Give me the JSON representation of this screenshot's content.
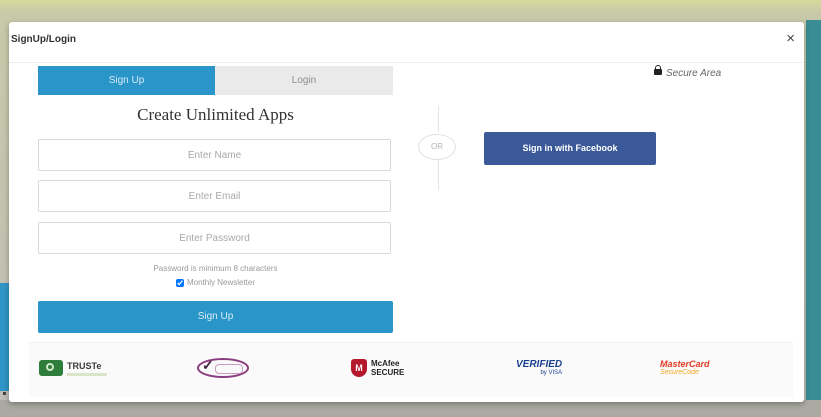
{
  "modal": {
    "title": "SignUp/Login",
    "close_glyph": "×",
    "secure_label": "Secure Area",
    "secure_icon": "lock-icon"
  },
  "tabs": [
    {
      "label": "Sign Up",
      "active": true
    },
    {
      "label": "Login",
      "active": false
    }
  ],
  "form": {
    "headline": "Create Unlimited Apps",
    "name_placeholder": "Enter Name",
    "email_placeholder": "Enter Email",
    "password_placeholder": "Enter Password",
    "password_hint": "Password is minimum 8 characters",
    "newsletter_label": "Monthly Newsletter",
    "newsletter_checked": true,
    "submit_label": "Sign Up"
  },
  "divider_label": "OR",
  "facebook_label": "Sign in with Facebook",
  "badges": {
    "truste": "TRUSTe",
    "mcafee_line1": "McAfee",
    "mcafee_line2": "SECURE",
    "visa_line1": "VERIFIED",
    "visa_line2": "by VISA",
    "mastercard_line1": "MasterCard",
    "mastercard_line2": "SecureCode"
  },
  "colors": {
    "primary": "#2a95c9",
    "facebook": "#3b5998",
    "tab_inactive": "#eaeaea"
  }
}
